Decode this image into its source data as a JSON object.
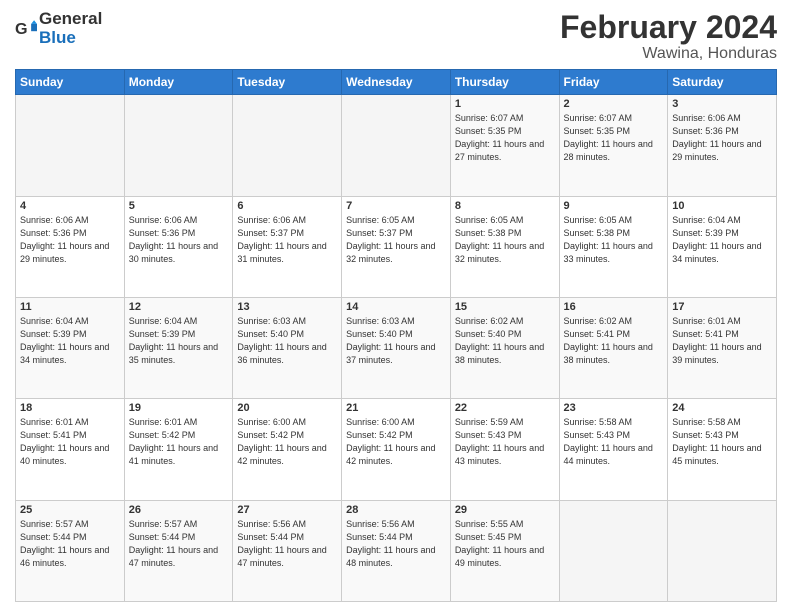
{
  "header": {
    "logo_general": "General",
    "logo_blue": "Blue",
    "month_year": "February 2024",
    "location": "Wawina, Honduras"
  },
  "weekdays": [
    "Sunday",
    "Monday",
    "Tuesday",
    "Wednesday",
    "Thursday",
    "Friday",
    "Saturday"
  ],
  "weeks": [
    [
      {
        "day": "",
        "sunrise": "",
        "sunset": "",
        "daylight": "",
        "empty": true
      },
      {
        "day": "",
        "sunrise": "",
        "sunset": "",
        "daylight": "",
        "empty": true
      },
      {
        "day": "",
        "sunrise": "",
        "sunset": "",
        "daylight": "",
        "empty": true
      },
      {
        "day": "",
        "sunrise": "",
        "sunset": "",
        "daylight": "",
        "empty": true
      },
      {
        "day": "1",
        "sunrise": "Sunrise: 6:07 AM",
        "sunset": "Sunset: 5:35 PM",
        "daylight": "Daylight: 11 hours and 27 minutes.",
        "empty": false
      },
      {
        "day": "2",
        "sunrise": "Sunrise: 6:07 AM",
        "sunset": "Sunset: 5:35 PM",
        "daylight": "Daylight: 11 hours and 28 minutes.",
        "empty": false
      },
      {
        "day": "3",
        "sunrise": "Sunrise: 6:06 AM",
        "sunset": "Sunset: 5:36 PM",
        "daylight": "Daylight: 11 hours and 29 minutes.",
        "empty": false
      }
    ],
    [
      {
        "day": "4",
        "sunrise": "Sunrise: 6:06 AM",
        "sunset": "Sunset: 5:36 PM",
        "daylight": "Daylight: 11 hours and 29 minutes.",
        "empty": false
      },
      {
        "day": "5",
        "sunrise": "Sunrise: 6:06 AM",
        "sunset": "Sunset: 5:36 PM",
        "daylight": "Daylight: 11 hours and 30 minutes.",
        "empty": false
      },
      {
        "day": "6",
        "sunrise": "Sunrise: 6:06 AM",
        "sunset": "Sunset: 5:37 PM",
        "daylight": "Daylight: 11 hours and 31 minutes.",
        "empty": false
      },
      {
        "day": "7",
        "sunrise": "Sunrise: 6:05 AM",
        "sunset": "Sunset: 5:37 PM",
        "daylight": "Daylight: 11 hours and 32 minutes.",
        "empty": false
      },
      {
        "day": "8",
        "sunrise": "Sunrise: 6:05 AM",
        "sunset": "Sunset: 5:38 PM",
        "daylight": "Daylight: 11 hours and 32 minutes.",
        "empty": false
      },
      {
        "day": "9",
        "sunrise": "Sunrise: 6:05 AM",
        "sunset": "Sunset: 5:38 PM",
        "daylight": "Daylight: 11 hours and 33 minutes.",
        "empty": false
      },
      {
        "day": "10",
        "sunrise": "Sunrise: 6:04 AM",
        "sunset": "Sunset: 5:39 PM",
        "daylight": "Daylight: 11 hours and 34 minutes.",
        "empty": false
      }
    ],
    [
      {
        "day": "11",
        "sunrise": "Sunrise: 6:04 AM",
        "sunset": "Sunset: 5:39 PM",
        "daylight": "Daylight: 11 hours and 34 minutes.",
        "empty": false
      },
      {
        "day": "12",
        "sunrise": "Sunrise: 6:04 AM",
        "sunset": "Sunset: 5:39 PM",
        "daylight": "Daylight: 11 hours and 35 minutes.",
        "empty": false
      },
      {
        "day": "13",
        "sunrise": "Sunrise: 6:03 AM",
        "sunset": "Sunset: 5:40 PM",
        "daylight": "Daylight: 11 hours and 36 minutes.",
        "empty": false
      },
      {
        "day": "14",
        "sunrise": "Sunrise: 6:03 AM",
        "sunset": "Sunset: 5:40 PM",
        "daylight": "Daylight: 11 hours and 37 minutes.",
        "empty": false
      },
      {
        "day": "15",
        "sunrise": "Sunrise: 6:02 AM",
        "sunset": "Sunset: 5:40 PM",
        "daylight": "Daylight: 11 hours and 38 minutes.",
        "empty": false
      },
      {
        "day": "16",
        "sunrise": "Sunrise: 6:02 AM",
        "sunset": "Sunset: 5:41 PM",
        "daylight": "Daylight: 11 hours and 38 minutes.",
        "empty": false
      },
      {
        "day": "17",
        "sunrise": "Sunrise: 6:01 AM",
        "sunset": "Sunset: 5:41 PM",
        "daylight": "Daylight: 11 hours and 39 minutes.",
        "empty": false
      }
    ],
    [
      {
        "day": "18",
        "sunrise": "Sunrise: 6:01 AM",
        "sunset": "Sunset: 5:41 PM",
        "daylight": "Daylight: 11 hours and 40 minutes.",
        "empty": false
      },
      {
        "day": "19",
        "sunrise": "Sunrise: 6:01 AM",
        "sunset": "Sunset: 5:42 PM",
        "daylight": "Daylight: 11 hours and 41 minutes.",
        "empty": false
      },
      {
        "day": "20",
        "sunrise": "Sunrise: 6:00 AM",
        "sunset": "Sunset: 5:42 PM",
        "daylight": "Daylight: 11 hours and 42 minutes.",
        "empty": false
      },
      {
        "day": "21",
        "sunrise": "Sunrise: 6:00 AM",
        "sunset": "Sunset: 5:42 PM",
        "daylight": "Daylight: 11 hours and 42 minutes.",
        "empty": false
      },
      {
        "day": "22",
        "sunrise": "Sunrise: 5:59 AM",
        "sunset": "Sunset: 5:43 PM",
        "daylight": "Daylight: 11 hours and 43 minutes.",
        "empty": false
      },
      {
        "day": "23",
        "sunrise": "Sunrise: 5:58 AM",
        "sunset": "Sunset: 5:43 PM",
        "daylight": "Daylight: 11 hours and 44 minutes.",
        "empty": false
      },
      {
        "day": "24",
        "sunrise": "Sunrise: 5:58 AM",
        "sunset": "Sunset: 5:43 PM",
        "daylight": "Daylight: 11 hours and 45 minutes.",
        "empty": false
      }
    ],
    [
      {
        "day": "25",
        "sunrise": "Sunrise: 5:57 AM",
        "sunset": "Sunset: 5:44 PM",
        "daylight": "Daylight: 11 hours and 46 minutes.",
        "empty": false
      },
      {
        "day": "26",
        "sunrise": "Sunrise: 5:57 AM",
        "sunset": "Sunset: 5:44 PM",
        "daylight": "Daylight: 11 hours and 47 minutes.",
        "empty": false
      },
      {
        "day": "27",
        "sunrise": "Sunrise: 5:56 AM",
        "sunset": "Sunset: 5:44 PM",
        "daylight": "Daylight: 11 hours and 47 minutes.",
        "empty": false
      },
      {
        "day": "28",
        "sunrise": "Sunrise: 5:56 AM",
        "sunset": "Sunset: 5:44 PM",
        "daylight": "Daylight: 11 hours and 48 minutes.",
        "empty": false
      },
      {
        "day": "29",
        "sunrise": "Sunrise: 5:55 AM",
        "sunset": "Sunset: 5:45 PM",
        "daylight": "Daylight: 11 hours and 49 minutes.",
        "empty": false
      },
      {
        "day": "",
        "sunrise": "",
        "sunset": "",
        "daylight": "",
        "empty": true
      },
      {
        "day": "",
        "sunrise": "",
        "sunset": "",
        "daylight": "",
        "empty": true
      }
    ]
  ]
}
